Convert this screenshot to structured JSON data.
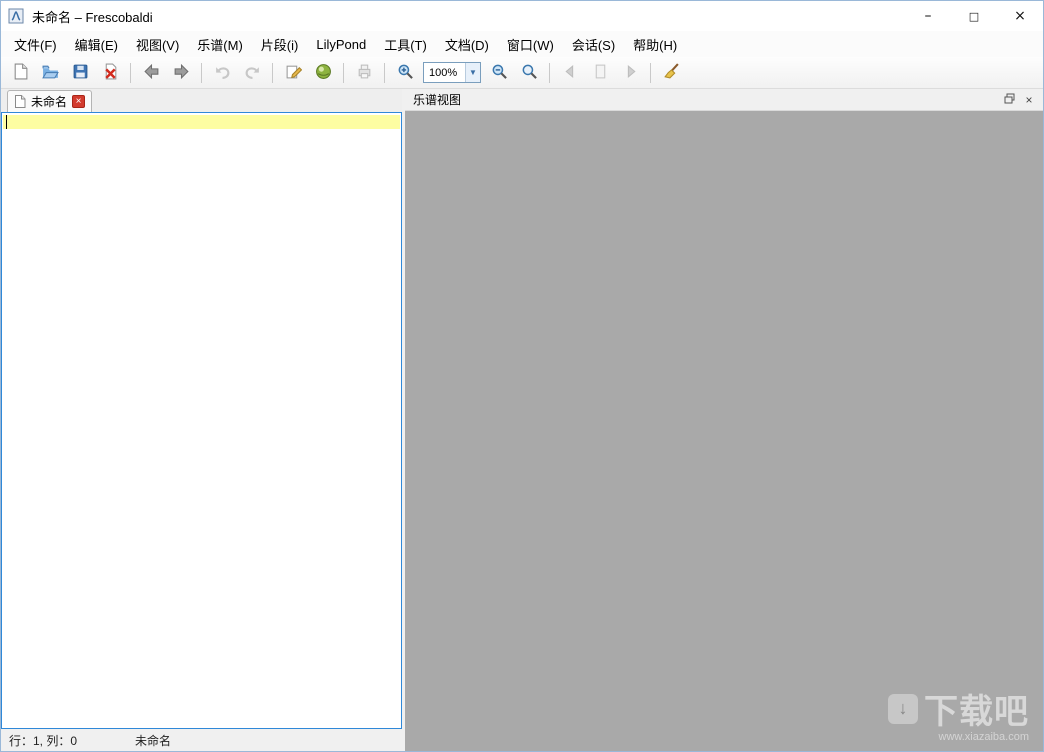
{
  "window": {
    "title": "未命名 – Frescobaldi",
    "controls": {
      "minimize": "–",
      "maximize": "□",
      "close": "×"
    }
  },
  "menu": {
    "items": [
      {
        "label": "文件(F)"
      },
      {
        "label": "编辑(E)"
      },
      {
        "label": "视图(V)"
      },
      {
        "label": "乐谱(M)"
      },
      {
        "label": "片段(i)"
      },
      {
        "label": "LilyPond"
      },
      {
        "label": "工具(T)"
      },
      {
        "label": "文档(D)"
      },
      {
        "label": "窗口(W)"
      },
      {
        "label": "会话(S)"
      },
      {
        "label": "帮助(H)"
      }
    ]
  },
  "toolbar": {
    "zoom_value": "100%",
    "icons": [
      "new-document-icon",
      "open-document-icon",
      "save-document-icon",
      "close-document-icon",
      "back-icon",
      "forward-icon",
      "undo-icon",
      "redo-icon",
      "edit-icon",
      "lilypond-engrave-icon",
      "print-icon",
      "zoom-in-icon",
      "zoom-out-icon",
      "zoom-original-icon",
      "previous-page-icon",
      "page-icon",
      "next-page-icon",
      "clear-music-icon"
    ]
  },
  "editor": {
    "tab_label": "未命名",
    "tab_close": "×",
    "status_line_col": "行：1, 列：0",
    "status_doc_name": "未命名"
  },
  "music_view": {
    "title": "乐谱视图"
  },
  "watermark": {
    "logo_glyph": "↓",
    "title": "下载吧",
    "url": "www.xiazaiba.com"
  },
  "colors": {
    "accent_blue": "#2f88d8",
    "line_highlight": "#fdfda2",
    "music_view_bg": "#a9a9a9",
    "tab_close_red": "#d23b2e"
  }
}
